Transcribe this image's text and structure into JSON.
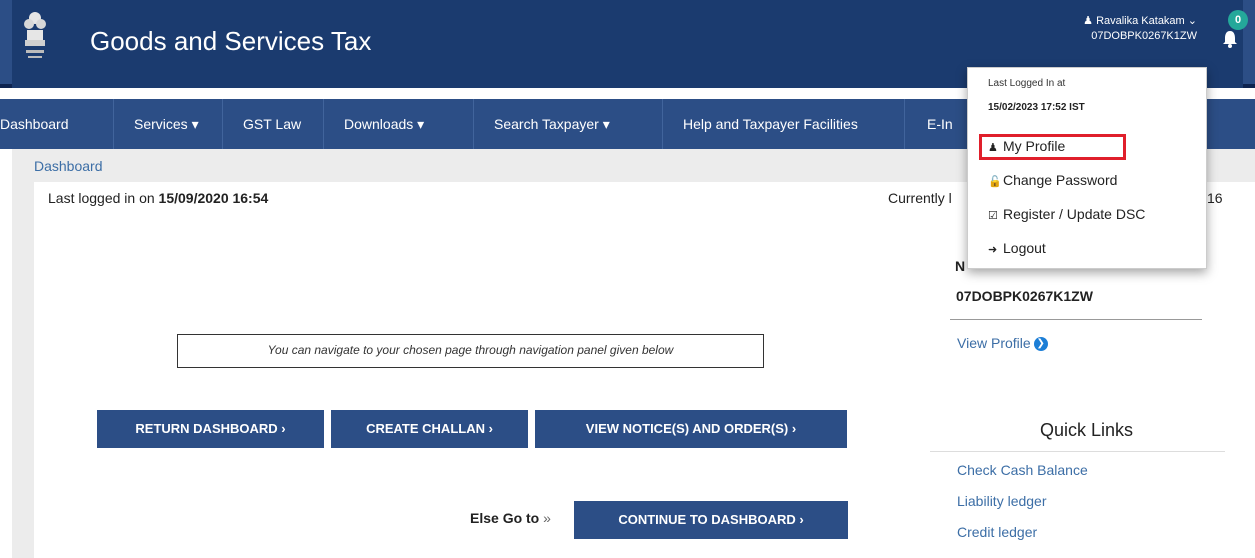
{
  "header": {
    "title": "Goods and Services Tax",
    "user_name": "Ravalika Katakam",
    "user_caret": "⌄",
    "user_gstin": "07DOBPK0267K1ZW",
    "notification_count": "0"
  },
  "nav": {
    "items": [
      "Dashboard",
      "Services ▾",
      "GST Law",
      "Downloads ▾",
      "Search Taxpayer ▾",
      "Help and Taxpayer Facilities",
      "E-In"
    ]
  },
  "breadcrumb": "Dashboard",
  "login_info": {
    "prefix": "Last logged in on ",
    "datetime": "15/09/2020 16:54",
    "currently_prefix": "Currently l",
    "currently_tail": "16"
  },
  "note": "You can navigate to your chosen page through navigation panel given below",
  "buttons": {
    "return_dashboard": "RETURN DASHBOARD ›",
    "create_challan": "CREATE CHALLAN ›",
    "view_notices": "VIEW NOTICE(S) AND ORDER(S) ›",
    "continue_dashboard": "CONTINUE TO DASHBOARD ›"
  },
  "else_go": {
    "text": "Else Go to",
    "arrow": "»"
  },
  "profile_side": {
    "label_fragment": "N",
    "gstin": "07DOBPK0267K1ZW",
    "view_profile": "View Profile"
  },
  "quick_links": {
    "title": "Quick Links",
    "items": [
      "Check Cash Balance",
      "Liability ledger",
      "Credit ledger"
    ]
  },
  "dropdown": {
    "last_logged_label": "Last Logged In at",
    "last_logged_value": "15/02/2023 17:52 IST",
    "items": [
      "My Profile",
      "Change Password",
      "Register / Update DSC",
      "Logout"
    ]
  },
  "colors": {
    "header_bg": "#1b3b6f",
    "nav_bg": "#2c4e86",
    "highlight": "#e01f2b",
    "badge": "#24a89a",
    "link": "#3c6ea6"
  }
}
